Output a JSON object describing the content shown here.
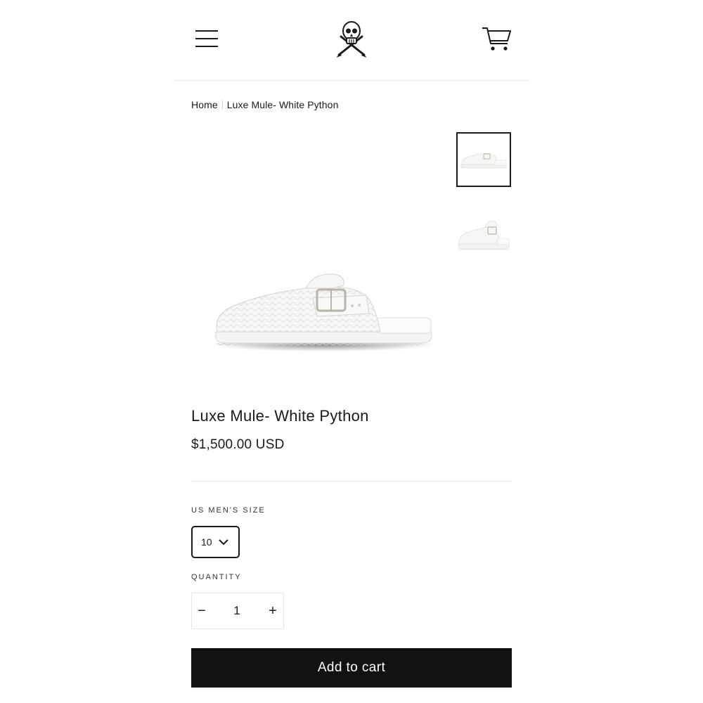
{
  "header": {
    "menu_icon": "hamburger-menu-icon",
    "logo": "skull-crossed-knives-logo",
    "cart_icon": "cart-icon"
  },
  "breadcrumb": {
    "home": "Home",
    "current": "Luxe Mule- White Python"
  },
  "product": {
    "title": "Luxe Mule- White Python",
    "price": "$1,500.00 USD",
    "size_label": "US MEN'S SIZE",
    "size_value": "10",
    "quantity_label": "QUANTITY",
    "quantity_value": "1",
    "minus": "−",
    "plus": "+",
    "add_to_cart": "Add to cart"
  },
  "colors": {
    "button_bg": "#121212",
    "text": "#1a1a1a",
    "rule": "#ececec"
  }
}
